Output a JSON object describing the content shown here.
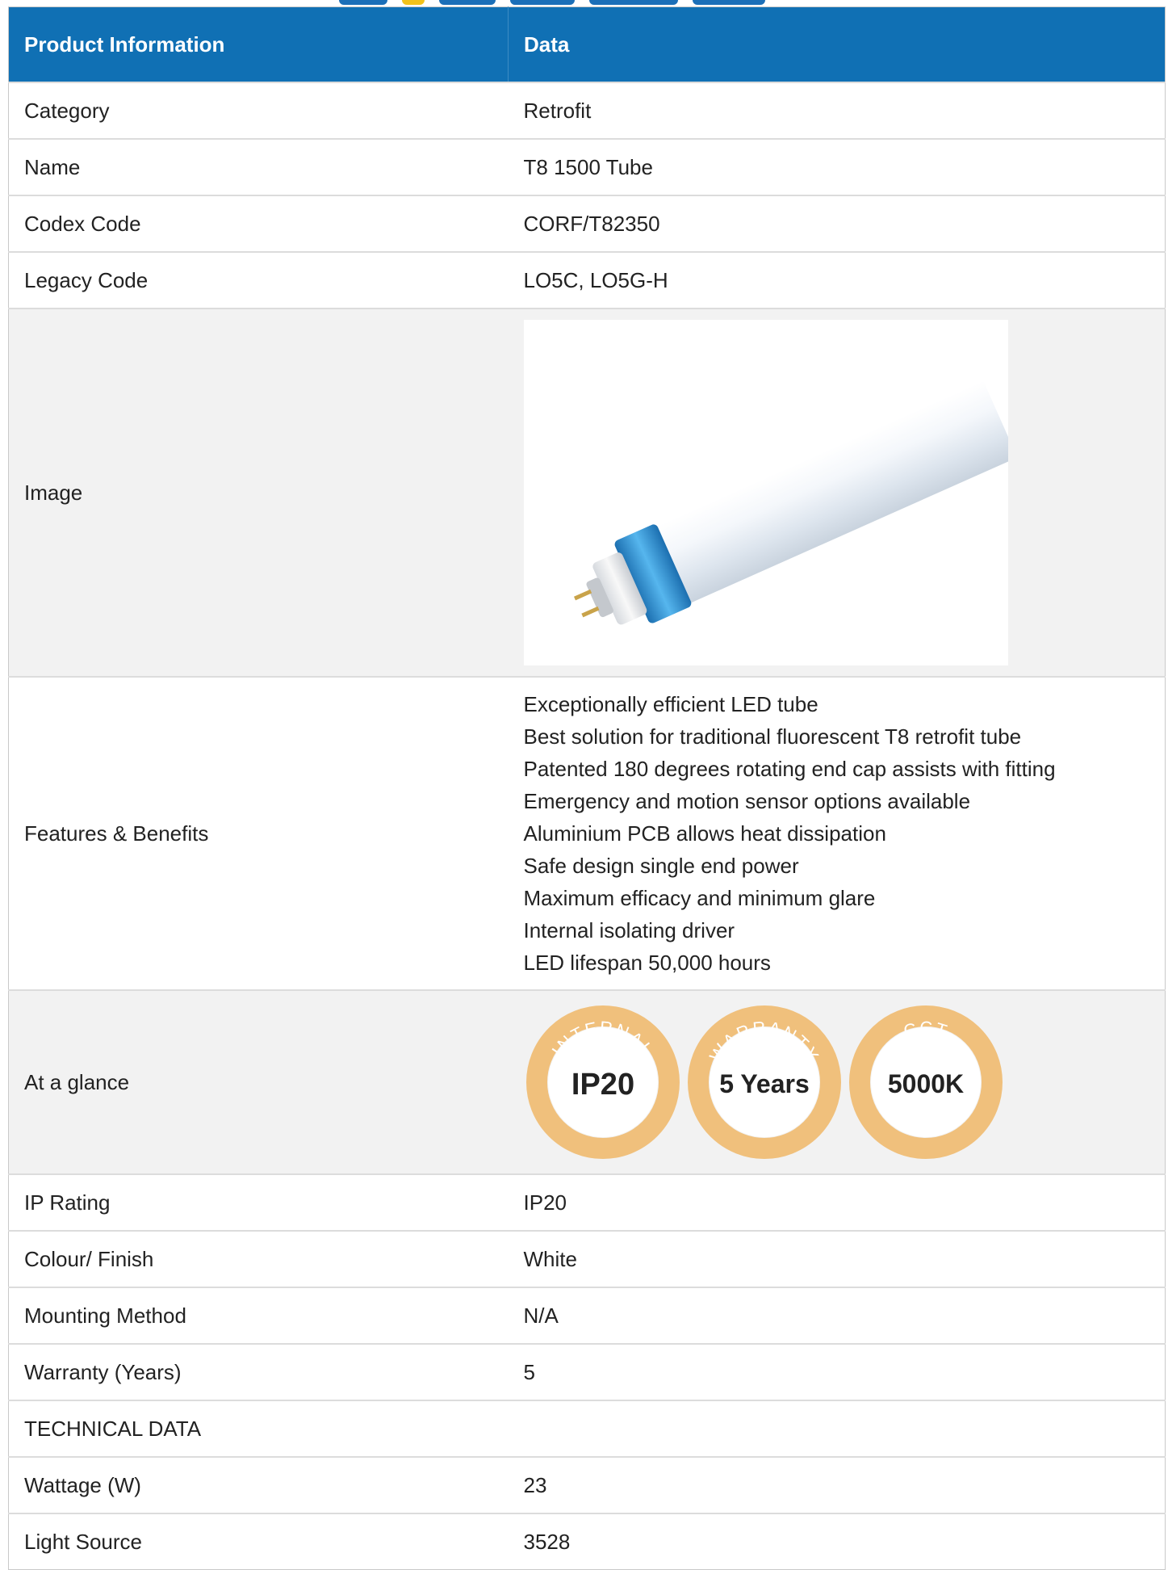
{
  "table": {
    "header": {
      "col1": "Product Information",
      "col2": "Data"
    },
    "rows": [
      {
        "label": "Category",
        "value": "Retrofit"
      },
      {
        "label": "Name",
        "value": "T8 1500 Tube"
      },
      {
        "label": "Codex Code",
        "value": "CORF/T82350"
      },
      {
        "label": "Legacy Code",
        "value": "LO5C, LO5G-H"
      },
      {
        "label": "Image"
      },
      {
        "label": "Features & Benefits",
        "features": [
          "Exceptionally efficient LED tube",
          "Best solution for traditional fluorescent T8 retrofit tube",
          "Patented 180 degrees rotating end cap assists with fitting",
          "Emergency and motion sensor options available",
          "Aluminium PCB allows heat dissipation",
          "Safe design single end power",
          "Maximum efficacy and minimum glare",
          "Internal isolating driver",
          "LED lifespan 50,000 hours"
        ]
      },
      {
        "label": "At a glance",
        "badges": [
          {
            "arc": "INTERNAL",
            "value": "IP20"
          },
          {
            "arc": "WARRANTY",
            "value": "5 Years"
          },
          {
            "arc": "CCT",
            "value": "5000K"
          }
        ]
      },
      {
        "label": "IP Rating",
        "value": "IP20"
      },
      {
        "label": "Colour/ Finish",
        "value": "White"
      },
      {
        "label": "Mounting Method",
        "value": "N/A"
      },
      {
        "label": "Warranty (Years)",
        "value": "5"
      },
      {
        "label": "TECHNICAL DATA",
        "value": ""
      },
      {
        "label": "Wattage (W)",
        "value": "23"
      },
      {
        "label": "Light Source",
        "value": "3528"
      }
    ]
  },
  "colors": {
    "header_bg": "#1070b4",
    "header_text": "#ffffff",
    "alt_row_bg": "#f2f2f2",
    "badge_ring": "#f0c07c",
    "tube_cap_blue": "#2c8fd0"
  }
}
